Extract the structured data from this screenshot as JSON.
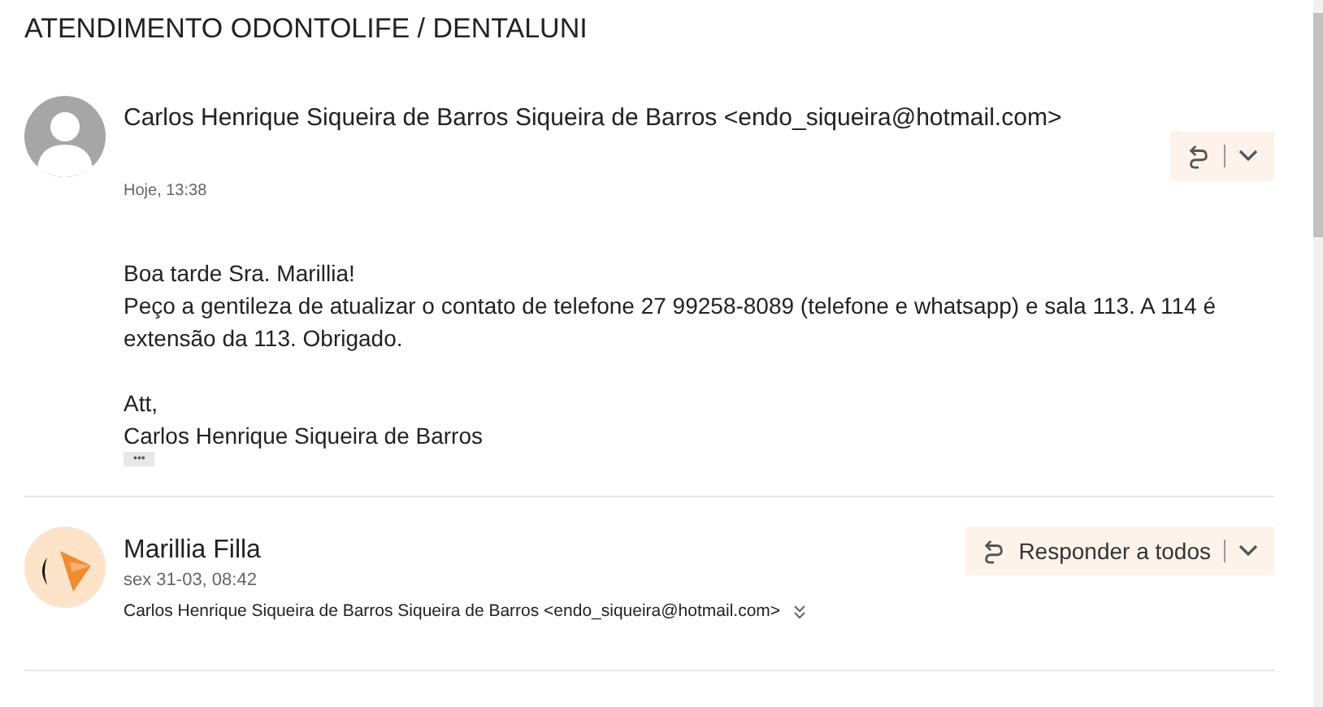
{
  "subject": "ATENDIMENTO ODONTOLIFE / DENTALUNI",
  "messages": [
    {
      "kind": "expanded",
      "sender": "Carlos Henrique Siqueira de Barros Siqueira de Barros <endo_siqueira@hotmail.com>",
      "date": "Hoje, 13:38",
      "body": [
        [
          "Boa tarde Sra. Marillia!",
          "Peço a gentileza de atualizar o contato de telefone 27 99258-8089 (telefone e whatsapp) e sala 113. A 114 é extensão da 113. Obrigado."
        ],
        [
          "Att,",
          "Carlos Henrique Siqueira de Barros"
        ]
      ],
      "more": "•••"
    },
    {
      "kind": "header",
      "sender": "Marillia Filla",
      "date": "sex 31-03, 08:42",
      "recipients": "Carlos Henrique Siqueira de Barros Siqueira de Barros <endo_siqueira@hotmail.com>",
      "reply_label": "Responder a todos"
    }
  ]
}
